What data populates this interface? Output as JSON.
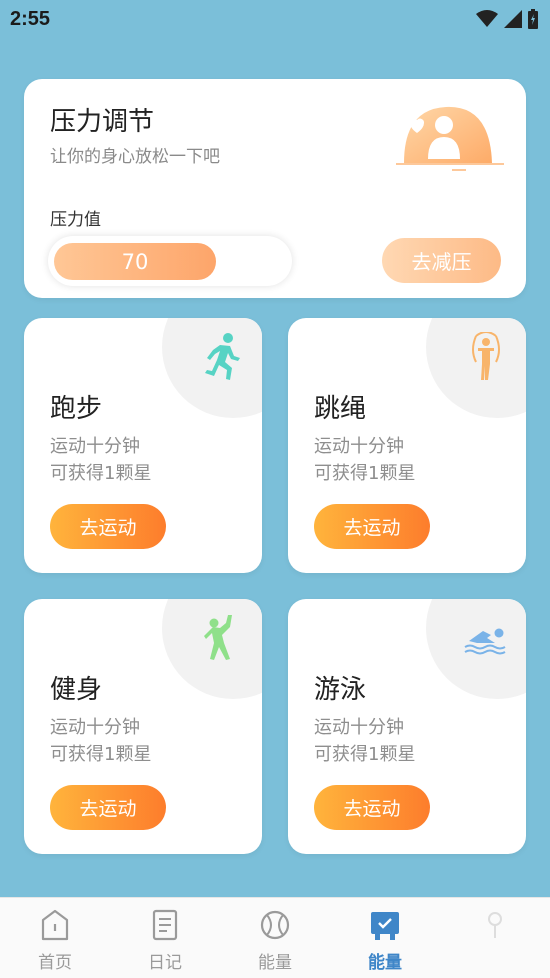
{
  "status": {
    "time": "2:55"
  },
  "stress": {
    "title": "压力调节",
    "subtitle": "让你的身心放松一下吧",
    "label": "压力值",
    "value": "70",
    "level_percent": 70,
    "relieve_label": "去减压"
  },
  "sports": [
    {
      "name": "跑步",
      "line1": "运动十分钟",
      "line2": "可获得1颗星",
      "button": "去运动",
      "icon": "running-icon"
    },
    {
      "name": "跳绳",
      "line1": "运动十分钟",
      "line2": "可获得1颗星",
      "button": "去运动",
      "icon": "jump-rope-icon"
    },
    {
      "name": "健身",
      "line1": "运动十分钟",
      "line2": "可获得1颗星",
      "button": "去运动",
      "icon": "fitness-icon"
    },
    {
      "name": "游泳",
      "line1": "运动十分钟",
      "line2": "可获得1颗星",
      "button": "去运动",
      "icon": "swimming-icon"
    }
  ],
  "tabs": [
    {
      "label": "首页",
      "icon": "home-icon"
    },
    {
      "label": "日记",
      "icon": "diary-icon"
    },
    {
      "label": "能量",
      "icon": "ball-icon"
    },
    {
      "label": "能量",
      "icon": "check-box-icon",
      "active": true
    },
    {
      "label": "",
      "icon": "partial-icon"
    }
  ],
  "colors": {
    "background": "#7bbfd9",
    "accent_orange": "#fd7d2c",
    "tab_active": "#3f86c8"
  }
}
